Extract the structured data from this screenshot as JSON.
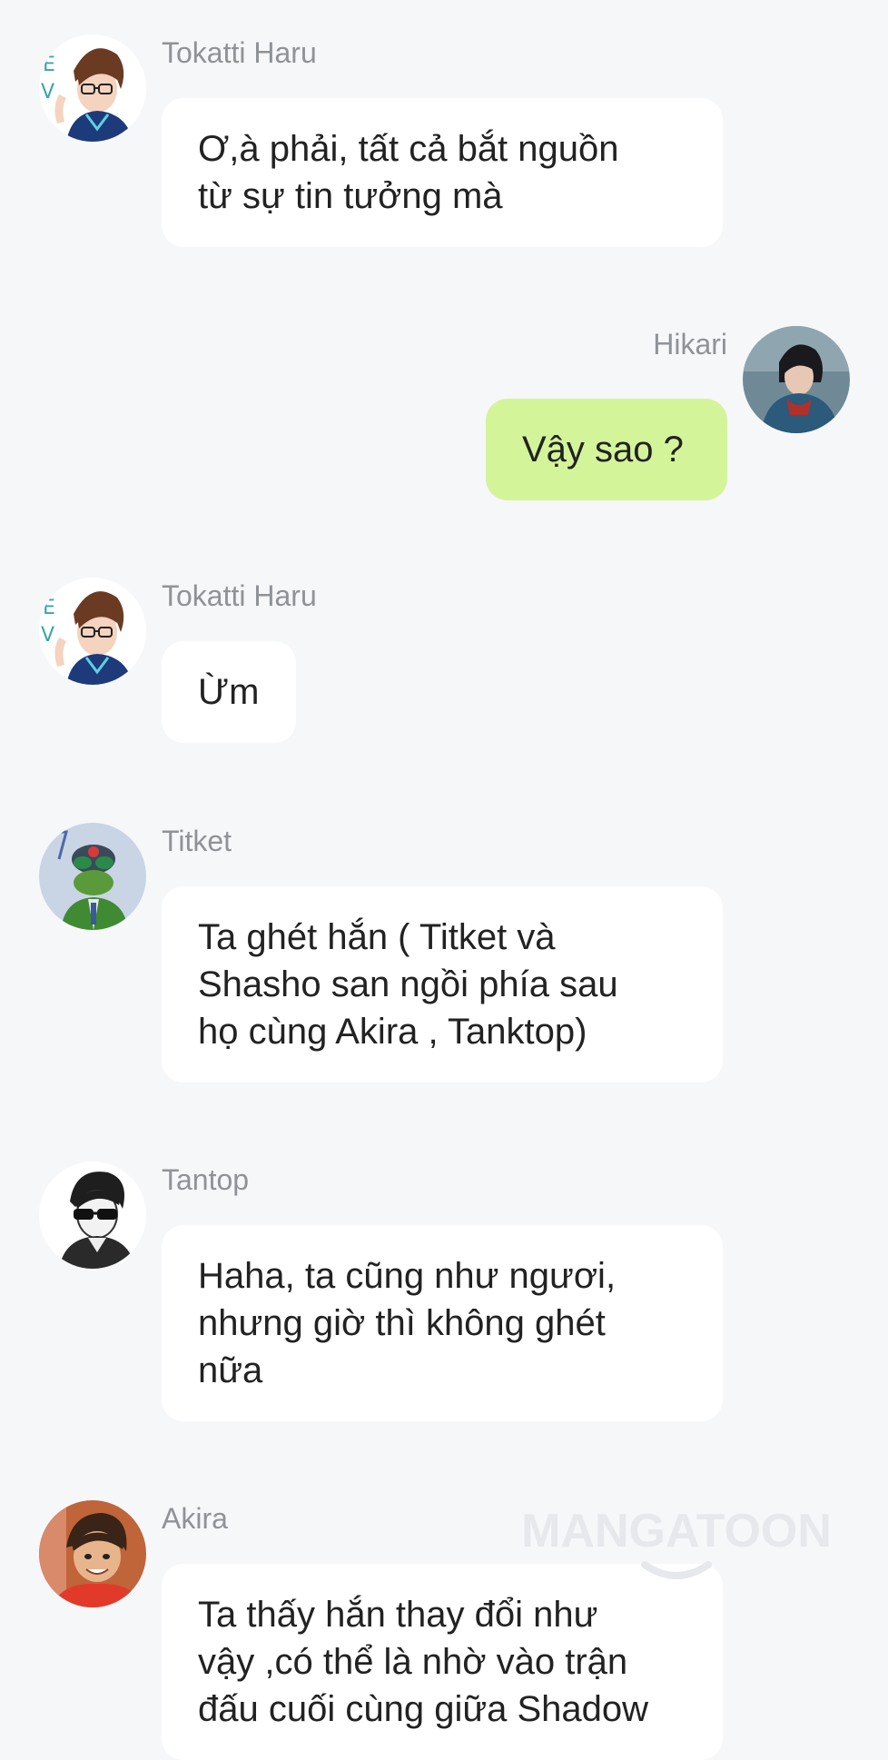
{
  "messages": [
    {
      "sender": "Tokatti Haru",
      "side": "left",
      "avatar_icon": "tokatti-haru-avatar",
      "lines": [
        "Ơ,à phải, tất cả bắt nguồn",
        "từ sự tin tưởng mà"
      ]
    },
    {
      "sender": "Hikari",
      "side": "right",
      "avatar_icon": "hikari-avatar",
      "lines": [
        "Vậy sao ?"
      ]
    },
    {
      "sender": "Tokatti Haru",
      "side": "left",
      "avatar_icon": "tokatti-haru-avatar",
      "lines": [
        "Ừm"
      ]
    },
    {
      "sender": "Titket",
      "side": "left",
      "avatar_icon": "titket-avatar",
      "lines": [
        "Ta ghét hắn ( Titket và",
        "Shasho san ngồi phía sau",
        "họ cùng Akira , Tanktop)"
      ]
    },
    {
      "sender": "Tantop",
      "side": "left",
      "avatar_icon": "tantop-avatar",
      "lines": [
        "Haha, ta cũng như ngươi,",
        "nhưng giờ thì không ghét",
        "nữa"
      ]
    },
    {
      "sender": "Akira",
      "side": "left",
      "avatar_icon": "akira-avatar",
      "lines": [
        "Ta thấy hắn thay đổi như",
        "vậy ,có thể là nhờ vào trận",
        "đấu cuối cùng giữa Shadow"
      ]
    }
  ],
  "watermark": "MANGATOON",
  "colors": {
    "background": "#f6f7f9",
    "bubble_other": "#ffffff",
    "bubble_mine": "#d4f49a",
    "sender_text": "#8f9296",
    "message_text": "#222222"
  }
}
